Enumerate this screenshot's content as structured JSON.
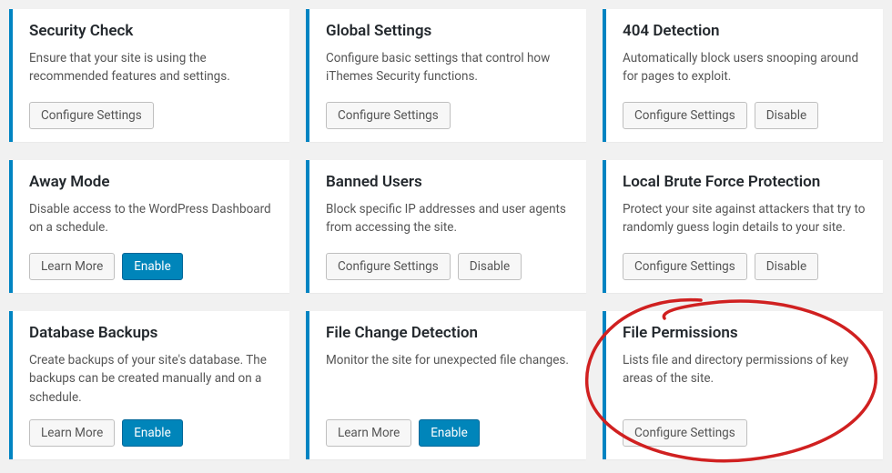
{
  "buttons": {
    "configure": "Configure Settings",
    "disable": "Disable",
    "learn_more": "Learn More",
    "enable": "Enable"
  },
  "cards": [
    {
      "title": "Security Check",
      "desc": "Ensure that your site is using the recommended features and settings.",
      "actions": [
        "configure"
      ]
    },
    {
      "title": "Global Settings",
      "desc": "Configure basic settings that control how iThemes Security functions.",
      "actions": [
        "configure"
      ]
    },
    {
      "title": "404 Detection",
      "desc": "Automatically block users snooping around for pages to exploit.",
      "actions": [
        "configure",
        "disable"
      ]
    },
    {
      "title": "Away Mode",
      "desc": "Disable access to the WordPress Dashboard on a schedule.",
      "actions": [
        "learn_more",
        "enable"
      ]
    },
    {
      "title": "Banned Users",
      "desc": "Block specific IP addresses and user agents from accessing the site.",
      "actions": [
        "configure",
        "disable"
      ]
    },
    {
      "title": "Local Brute Force Protection",
      "desc": "Protect your site against attackers that try to randomly guess login details to your site.",
      "actions": [
        "configure",
        "disable"
      ]
    },
    {
      "title": "Database Backups",
      "desc": "Create backups of your site's database. The backups can be created manually and on a schedule.",
      "actions": [
        "learn_more",
        "enable"
      ]
    },
    {
      "title": "File Change Detection",
      "desc": "Monitor the site for unexpected file changes.",
      "actions": [
        "learn_more",
        "enable"
      ]
    },
    {
      "title": "File Permissions",
      "desc": "Lists file and directory permissions of key areas of the site.",
      "actions": [
        "configure"
      ]
    }
  ]
}
